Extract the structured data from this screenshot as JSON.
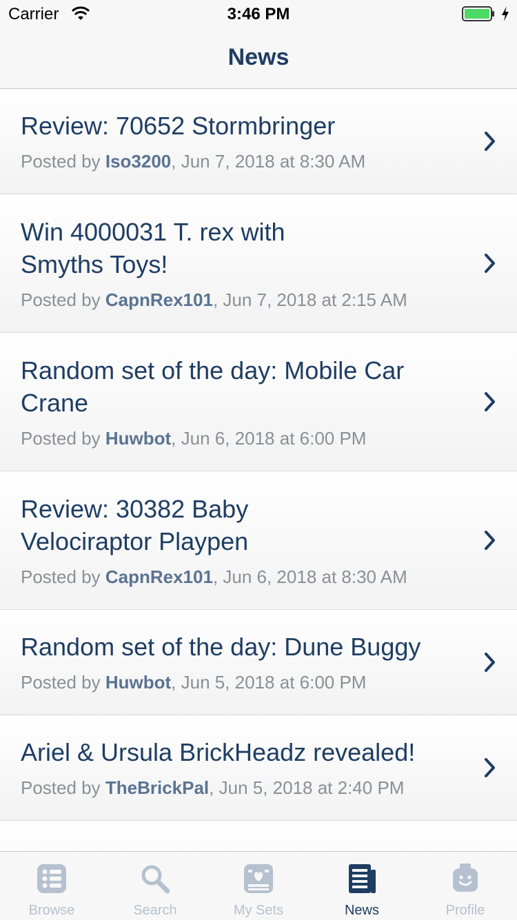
{
  "status_bar": {
    "carrier": "Carrier",
    "time": "3:46 PM",
    "wifi_icon": "wifi-icon",
    "battery_icon": "battery-icon"
  },
  "navbar": {
    "title": "News"
  },
  "news": {
    "items": [
      {
        "title": "Review: 70652 Stormbringer",
        "posted_by_prefix": "Posted by ",
        "author": "Iso3200",
        "date": ", Jun 7, 2018 at 8:30 AM"
      },
      {
        "title": "Win 4000031 T. rex with Smyths Toys!",
        "posted_by_prefix": "Posted by ",
        "author": "CapnRex101",
        "date": ", Jun 7, 2018 at 2:15 AM"
      },
      {
        "title": "Random set of the day: Mobile Car Crane",
        "posted_by_prefix": "Posted by ",
        "author": "Huwbot",
        "date": ", Jun 6, 2018 at 6:00 PM"
      },
      {
        "title": "Review: 30382 Baby Velociraptor Playpen",
        "posted_by_prefix": "Posted by ",
        "author": "CapnRex101",
        "date": ", Jun 6, 2018 at 8:30 AM"
      },
      {
        "title": "Random set of the day: Dune Buggy",
        "posted_by_prefix": "Posted by ",
        "author": "Huwbot",
        "date": ", Jun 5, 2018 at 6:00 PM"
      },
      {
        "title": "Ariel & Ursula BrickHeadz revealed!",
        "posted_by_prefix": "Posted by ",
        "author": "TheBrickPal",
        "date": ", Jun 5, 2018 at 2:40 PM"
      }
    ]
  },
  "tabbar": {
    "tabs": [
      {
        "label": "Browse",
        "icon": "browse-icon"
      },
      {
        "label": "Search",
        "icon": "search-icon"
      },
      {
        "label": "My Sets",
        "icon": "my-sets-icon"
      },
      {
        "label": "News",
        "icon": "news-icon"
      },
      {
        "label": "Profile",
        "icon": "profile-icon"
      }
    ],
    "active": "News"
  },
  "colors": {
    "title_text": "#1e3d63",
    "author_text": "#5a7392",
    "meta_text": "#8a8f96",
    "inactive_tab": "#b5c1cf",
    "battery": "#4cd964"
  }
}
